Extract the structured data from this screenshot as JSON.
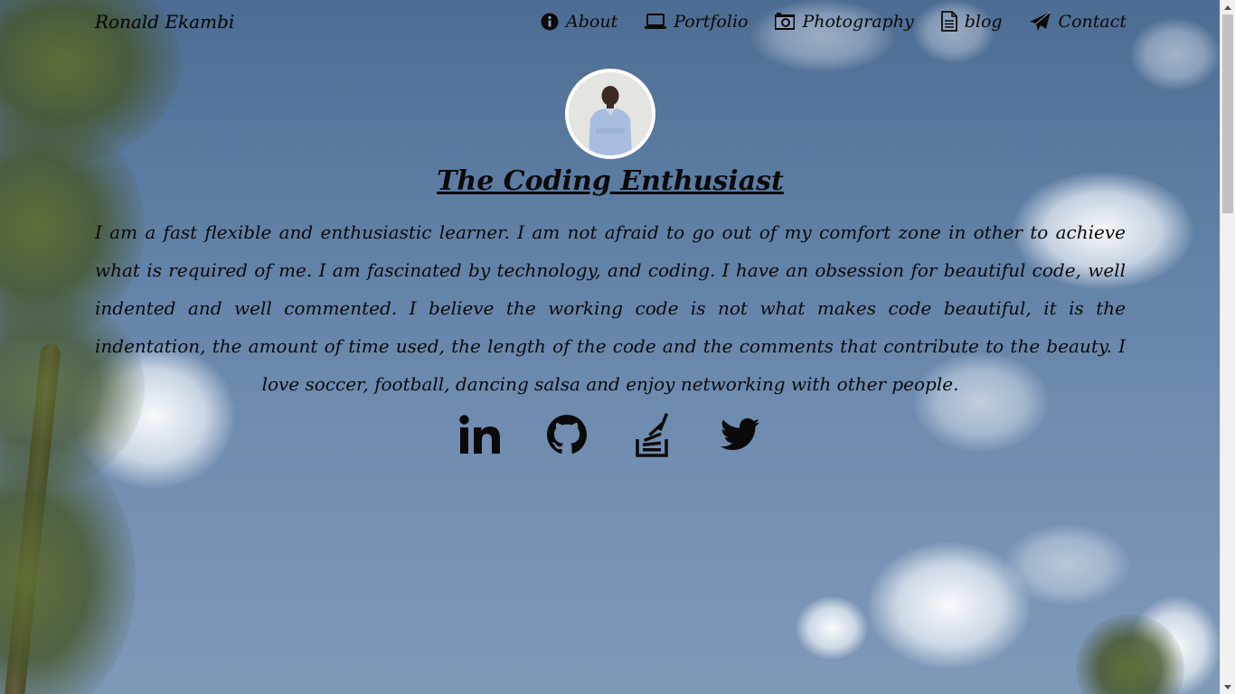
{
  "header": {
    "brand": "Ronald Ekambi"
  },
  "nav": {
    "items": [
      {
        "label": "About",
        "icon": "info-circle-icon"
      },
      {
        "label": "Portfolio",
        "icon": "laptop-icon"
      },
      {
        "label": "Photography",
        "icon": "camera-icon"
      },
      {
        "label": "blog",
        "icon": "document-icon"
      },
      {
        "label": "Contact",
        "icon": "paper-plane-icon"
      }
    ]
  },
  "profile": {
    "title": "The Coding Enthusiast",
    "bio": "I am a fast flexible and enthusiastic learner. I am not afraid to go out of my comfort zone in other to achieve what is required of me. I am fascinated by technology, and coding. I have an obsession for beautiful code, well indented and well commented. I believe the working code is not what makes code beautiful, it is the indentation, the amount of time used, the length of the code and the comments that contribute to the beauty. I love soccer, football, dancing salsa and enjoy networking with other people."
  },
  "social": [
    {
      "icon": "linkedin-icon"
    },
    {
      "icon": "github-icon"
    },
    {
      "icon": "stackoverflow-icon"
    },
    {
      "icon": "twitter-icon"
    }
  ],
  "colors": {
    "text": "#0a0a0a",
    "sky": "#5e7ea4",
    "avatar_border": "#ffffff"
  }
}
